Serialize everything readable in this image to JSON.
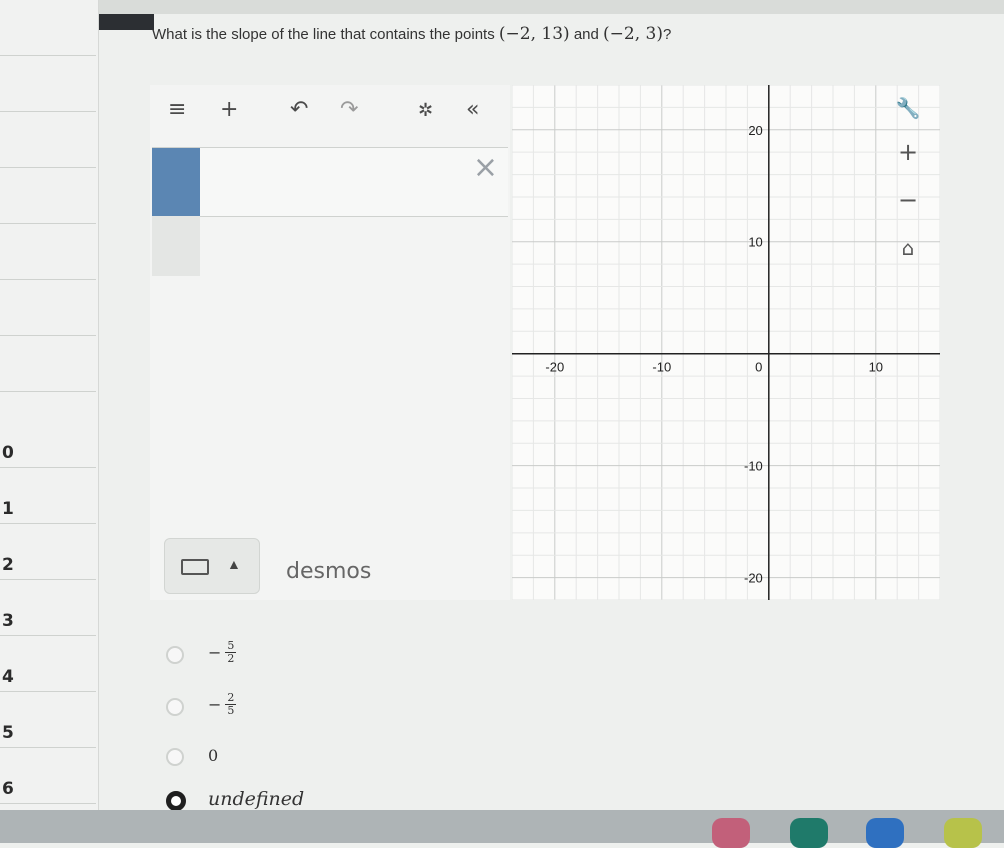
{
  "question": {
    "prefix": "What is the slope of the line that contains the points",
    "point1": "(−2, 13)",
    "conjunction": "and",
    "point2": "(−2, 3)",
    "suffix": "?"
  },
  "sidebar": {
    "question_numbers": [
      "0",
      "1",
      "2",
      "3",
      "4",
      "5",
      "6"
    ]
  },
  "desmos": {
    "toolbar": {
      "menu_icon": "≡",
      "add_icon": "+",
      "undo_icon": "↶",
      "redo_icon": "↷",
      "settings_icon": "✲",
      "collapse_icon": "«"
    },
    "expression_input": "",
    "delete_icon": "×",
    "brand": "desmos",
    "graph": {
      "x_range": [
        -24,
        16
      ],
      "y_range": [
        -22,
        24
      ],
      "grid": true,
      "x_ticks": [
        -20,
        -10,
        0,
        10
      ],
      "y_ticks": [
        20,
        10,
        -10,
        -20
      ],
      "x_tick_labels": [
        "-20",
        "-10",
        "0",
        "10"
      ],
      "y_tick_labels": [
        "20",
        "10",
        "-10",
        "-20"
      ]
    },
    "controls": {
      "settings_icon": "wrench-icon",
      "zoom_in_label": "+",
      "zoom_out_label": "−",
      "home_label": "⌂"
    }
  },
  "answers": {
    "choices": [
      {
        "sign": "−",
        "numerator": "5",
        "denominator": "2",
        "selected": false
      },
      {
        "sign": "−",
        "numerator": "2",
        "denominator": "5",
        "selected": false
      },
      {
        "label": "0",
        "selected": false
      },
      {
        "label": "undefined",
        "selected": true
      }
    ]
  },
  "colors": {
    "expression_tab": "#5b86b3",
    "selected_radio": "#1f1f1f"
  }
}
